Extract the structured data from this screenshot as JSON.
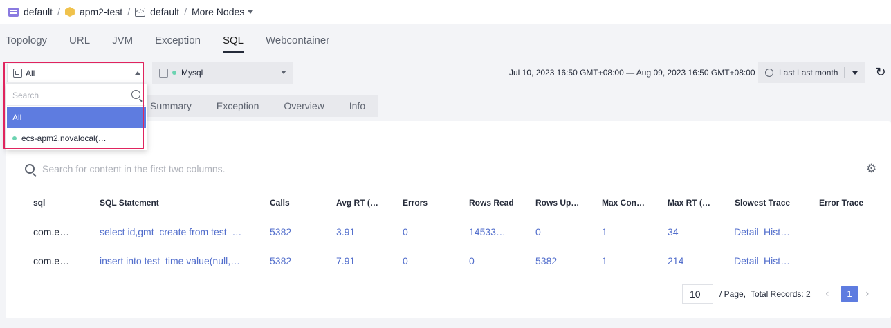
{
  "breadcrumb": {
    "items": [
      "default",
      "apm2-test",
      "default"
    ],
    "more": "More Nodes",
    "separator": "/"
  },
  "tabs": [
    "Topology",
    "URL",
    "JVM",
    "Exception",
    "SQL",
    "Webcontainer"
  ],
  "active_tab": "SQL",
  "node_select": {
    "value": "All"
  },
  "db_select": {
    "value": "Mysql"
  },
  "time": {
    "range": "Jul 10, 2023 16:50 GMT+08:00 — Aug 09, 2023 16:50 GMT+08:00",
    "preset": "Last Last month"
  },
  "subtabs": [
    "Summary",
    "Exception",
    "Overview",
    "Info"
  ],
  "search": {
    "placeholder": "Search for content in the first two columns."
  },
  "table": {
    "headers": [
      "sql",
      "SQL Statement",
      "Calls",
      "Avg RT (…",
      "Errors",
      "Rows Read",
      "Rows Up…",
      "Max Con…",
      "Max RT (…",
      "Slowest Trace",
      "Error Trace"
    ],
    "rows": [
      [
        "com.e…",
        "select id,gmt_create from test_…",
        "5382",
        "3.91",
        "0",
        "14533…",
        "0",
        "1",
        "34",
        "Detail",
        "Hist…"
      ],
      [
        "com.e…",
        "insert into test_time value(null,…",
        "5382",
        "7.91",
        "0",
        "0",
        "5382",
        "1",
        "214",
        "Detail",
        "Hist…"
      ]
    ]
  },
  "pagination": {
    "page_size": "10",
    "page_label": "/ Page,",
    "total": "Total Records: 2",
    "current": "1"
  },
  "dropdown": {
    "search_placeholder": "Search",
    "items": [
      "All",
      "ecs-apm2.novalocal(…"
    ]
  },
  "colors": {
    "accent": "#5e7ce0",
    "link": "#526ecc",
    "highlight": "#e0245e",
    "status_dot": "#6cd3b1"
  }
}
